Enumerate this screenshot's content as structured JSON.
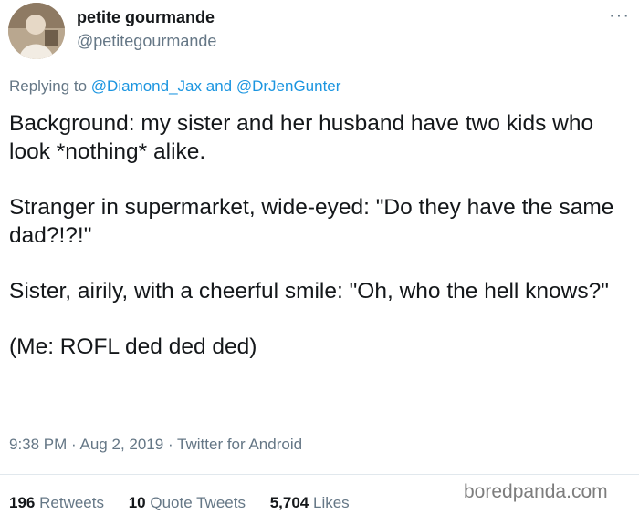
{
  "author": {
    "display_name": "petite gourmande",
    "handle": "@petitegourmande"
  },
  "more_icon": "more-horizontal-icon",
  "reply": {
    "prefix": "Replying to",
    "mention1": "@Diamond_Jax",
    "and": "and",
    "mention2": "@DrJenGunter"
  },
  "body": {
    "p1": "Background: my sister and her husband have two kids who look *nothing* alike.",
    "p2": "Stranger in supermarket, wide-eyed: \"Do they have the same dad?!?!\"",
    "p3": "Sister, airily, with a cheerful smile: \"Oh, who the hell knows?\"",
    "p4": "(Me: ROFL ded ded ded)"
  },
  "meta": {
    "time": "9:38 PM",
    "date": "Aug 2, 2019",
    "source": "Twitter for Android",
    "separator": "·"
  },
  "stats": {
    "retweets_count": "196",
    "retweets_label": "Retweets",
    "quotes_count": "10",
    "quotes_label": "Quote Tweets",
    "likes_count": "5,704",
    "likes_label": "Likes"
  },
  "watermark": "boredpanda.com",
  "colors": {
    "link": "#1b95e0",
    "secondary": "#657786",
    "text": "#14171a"
  }
}
